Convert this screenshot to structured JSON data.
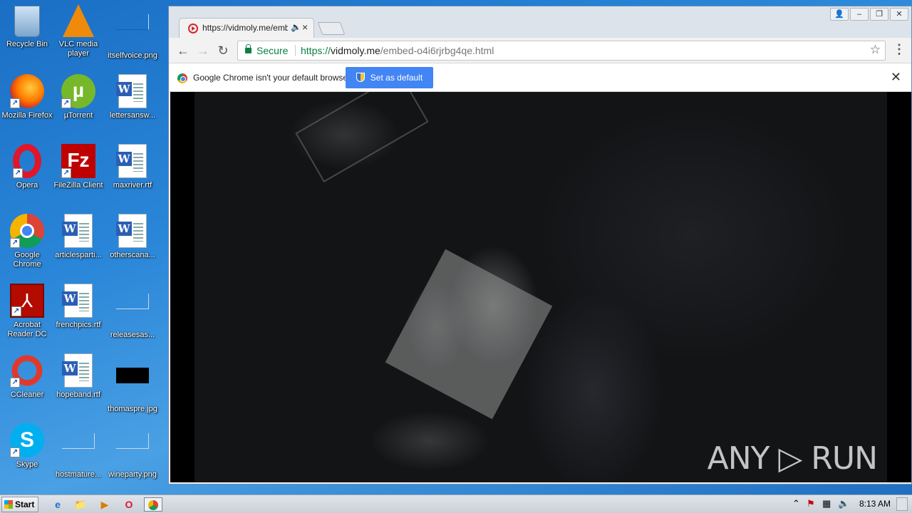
{
  "desktop": {
    "icons": [
      {
        "label": "Recycle Bin"
      },
      {
        "label": "VLC media player"
      },
      {
        "label": "itselfvoice.png"
      },
      {
        "label": "Mozilla Firefox"
      },
      {
        "label": "µTorrent"
      },
      {
        "label": "lettersansw..."
      },
      {
        "label": "Opera"
      },
      {
        "label": "FileZilla Client"
      },
      {
        "label": "maxriver.rtf"
      },
      {
        "label": "Google Chrome"
      },
      {
        "label": "articlesparti..."
      },
      {
        "label": "otherscana..."
      },
      {
        "label": "Acrobat Reader DC"
      },
      {
        "label": "frenchpics.rtf"
      },
      {
        "label": "releasesas..."
      },
      {
        "label": "CCleaner"
      },
      {
        "label": "hopeband.rtf"
      },
      {
        "label": "thomaspre.jpg"
      },
      {
        "label": "Skype"
      },
      {
        "label": "hostmature..."
      },
      {
        "label": "wineparty.png"
      }
    ]
  },
  "browser": {
    "tab_title": "https://vidmoly.me/embed",
    "tab_close": "×",
    "url_secure_label": "Secure",
    "url_scheme": "https://",
    "url_host": "vidmoly.me",
    "url_path": "/embed-o4i6rjrbg4qe.html",
    "infobar_message": "Google Chrome isn't your default browser.",
    "set_default_label": "Set as default",
    "infobar_close": "✕"
  },
  "video": {
    "watermark": "ANY ▷ RUN"
  },
  "taskbar": {
    "start_label": "Start",
    "clock": "8:13 AM"
  }
}
